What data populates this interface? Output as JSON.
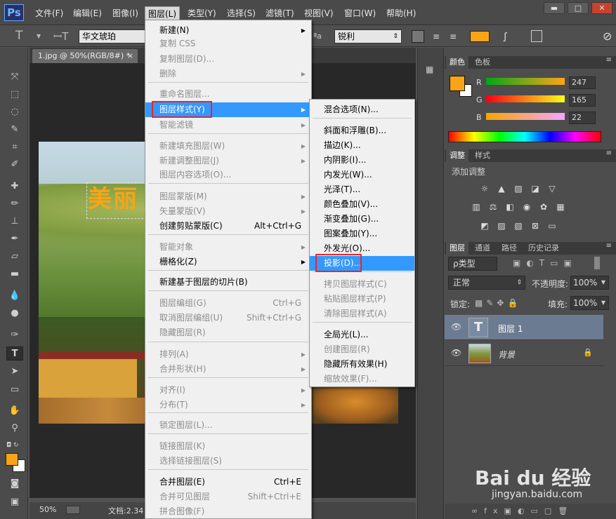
{
  "app": {
    "logo": "Ps"
  },
  "menubar": {
    "items": [
      "文件(F)",
      "编辑(E)",
      "图像(I)",
      "图层(L)",
      "类型(Y)",
      "选择(S)",
      "滤镜(T)",
      "视图(V)",
      "窗口(W)",
      "帮助(H)"
    ],
    "active": "图层(L)"
  },
  "window_controls": {
    "minimize": "▬",
    "maximize": "□",
    "close": "✕"
  },
  "options_bar": {
    "font_family": "华文琥珀",
    "aa_label": "ªa",
    "antialias": "锐利",
    "text_color": "#f7a516"
  },
  "document": {
    "tab_label": "1.jpg @ 50%(RGB/8#) *",
    "tab_close": "×",
    "canvas_text": "美丽",
    "zoom": "50%",
    "doc_info": "文档:2.34"
  },
  "layer_menu": {
    "items": [
      {
        "label": "新建(N)",
        "disabled": false,
        "arrow": true
      },
      {
        "label": "复制 CSS",
        "disabled": true
      },
      {
        "label": "复制图层(D)...",
        "disabled": true
      },
      {
        "label": "删除",
        "disabled": true,
        "arrow": true
      },
      {
        "label": "重命名图层...",
        "disabled": true
      },
      {
        "label": "图层样式(Y)",
        "disabled": false,
        "arrow": true,
        "highlighted": true
      },
      {
        "label": "智能滤镜",
        "disabled": true,
        "arrow": true
      },
      {
        "label": "新建填充图层(W)",
        "disabled": true,
        "arrow": true
      },
      {
        "label": "新建调整图层(J)",
        "disabled": true,
        "arrow": true
      },
      {
        "label": "图层内容选项(O)...",
        "disabled": true
      },
      {
        "label": "图层蒙版(M)",
        "disabled": true,
        "arrow": true
      },
      {
        "label": "矢量蒙版(V)",
        "disabled": true,
        "arrow": true
      },
      {
        "label": "创建剪贴蒙版(C)",
        "shortcut": "Alt+Ctrl+G",
        "disabled": false
      },
      {
        "label": "智能对象",
        "disabled": true,
        "arrow": true
      },
      {
        "label": "栅格化(Z)",
        "disabled": false,
        "arrow": true
      },
      {
        "label": "新建基于图层的切片(B)",
        "disabled": false
      },
      {
        "label": "图层编组(G)",
        "shortcut": "Ctrl+G",
        "disabled": true
      },
      {
        "label": "取消图层编组(U)",
        "shortcut": "Shift+Ctrl+G",
        "disabled": true
      },
      {
        "label": "隐藏图层(R)",
        "disabled": true
      },
      {
        "label": "排列(A)",
        "disabled": true,
        "arrow": true
      },
      {
        "label": "合并形状(H)",
        "disabled": true,
        "arrow": true
      },
      {
        "label": "对齐(I)",
        "disabled": true,
        "arrow": true
      },
      {
        "label": "分布(T)",
        "disabled": true,
        "arrow": true
      },
      {
        "label": "锁定图层(L)...",
        "disabled": true
      },
      {
        "label": "链接图层(K)",
        "disabled": true
      },
      {
        "label": "选择链接图层(S)",
        "disabled": true
      },
      {
        "label": "合并图层(E)",
        "shortcut": "Ctrl+E",
        "disabled": false
      },
      {
        "label": "合并可见图层",
        "shortcut": "Shift+Ctrl+E",
        "disabled": true
      },
      {
        "label": "拼合图像(F)",
        "disabled": true
      }
    ]
  },
  "style_submenu": {
    "items": [
      {
        "label": "混合选项(N)...",
        "disabled": false
      },
      {
        "label": "斜面和浮雕(B)...",
        "disabled": false
      },
      {
        "label": "描边(K)...",
        "disabled": false
      },
      {
        "label": "内阴影(I)...",
        "disabled": false
      },
      {
        "label": "内发光(W)...",
        "disabled": false
      },
      {
        "label": "光泽(T)...",
        "disabled": false
      },
      {
        "label": "颜色叠加(V)...",
        "disabled": false
      },
      {
        "label": "渐变叠加(G)...",
        "disabled": false
      },
      {
        "label": "图案叠加(Y)...",
        "disabled": false
      },
      {
        "label": "外发光(O)...",
        "disabled": false
      },
      {
        "label": "投影(D)...",
        "disabled": false,
        "highlighted": true
      },
      {
        "label": "拷贝图层样式(C)",
        "disabled": true
      },
      {
        "label": "粘贴图层样式(P)",
        "disabled": true
      },
      {
        "label": "清除图层样式(A)",
        "disabled": true
      },
      {
        "label": "全局光(L)...",
        "disabled": false
      },
      {
        "label": "创建图层(R)",
        "disabled": true
      },
      {
        "label": "隐藏所有效果(H)",
        "disabled": false
      },
      {
        "label": "缩放效果(F)...",
        "disabled": true
      }
    ]
  },
  "color_panel": {
    "tabs": [
      "颜色",
      "色板"
    ],
    "labels": {
      "r": "R",
      "g": "G",
      "b": "B"
    },
    "r": "247",
    "g": "165",
    "b": "22",
    "foreground": "#f7a516"
  },
  "adjust_panel": {
    "tabs": [
      "调整",
      "样式"
    ],
    "title": "添加调整"
  },
  "layers_panel": {
    "tabs": [
      "图层",
      "通道",
      "路径",
      "历史记录"
    ],
    "filter_label": "ρ类型",
    "blend_mode": "正常",
    "opacity_label": "不透明度:",
    "opacity": "100%",
    "lock_label": "锁定:",
    "fill_label": "填充:",
    "fill": "100%",
    "layers": [
      {
        "name": "图层 1",
        "thumb": "T",
        "selected": true
      },
      {
        "name": "背景",
        "locked": true
      }
    ]
  },
  "watermark": {
    "brand": "Bai du 经验",
    "url": "jingyan.baidu.com"
  }
}
